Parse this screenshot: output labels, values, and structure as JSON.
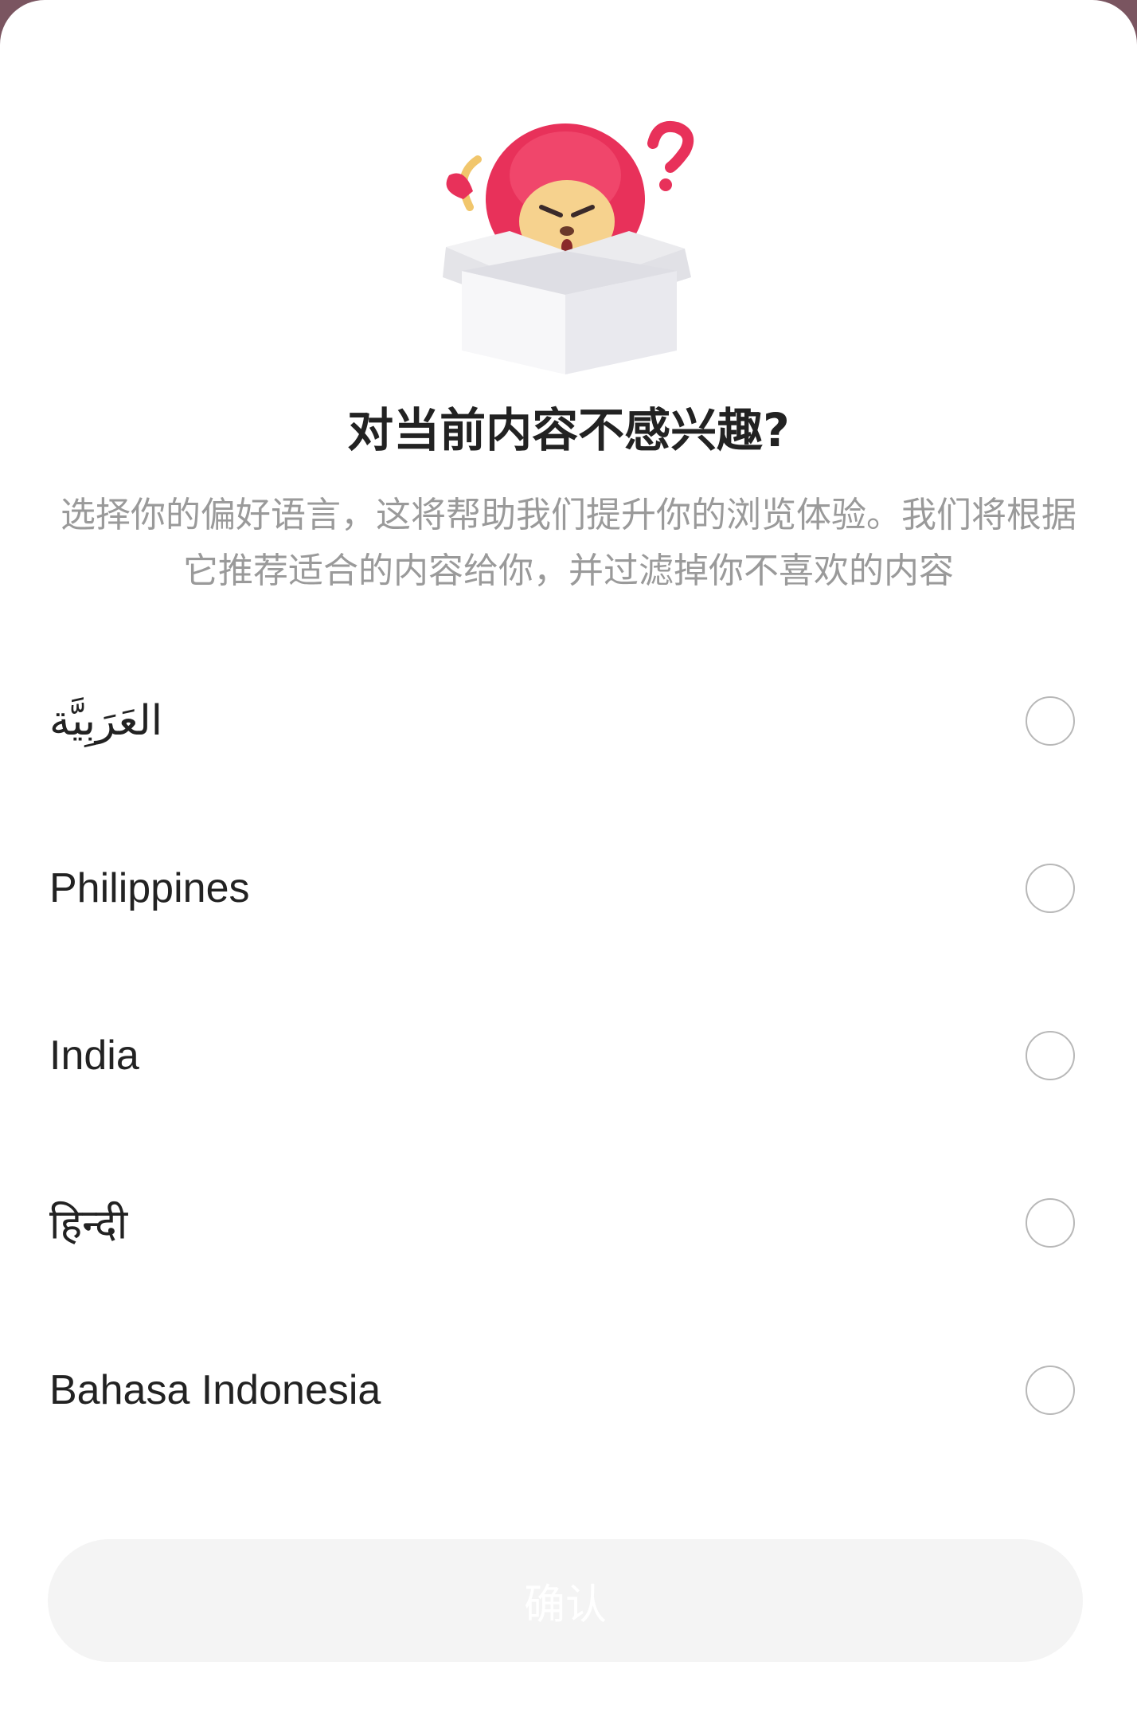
{
  "dialog": {
    "title": "对当前内容不感兴趣?",
    "subtitle": "选择你的偏好语言，这将帮助我们提升你的浏览体验。我们将根据它推荐适合的内容给你，并过滤掉你不喜欢的内容",
    "mascot_icon": "lion-in-box-question-mark-illustration"
  },
  "languages": [
    {
      "label": "العَرَبِيَّة",
      "selected": false
    },
    {
      "label": "Philippines",
      "selected": false
    },
    {
      "label": "India",
      "selected": false
    },
    {
      "label": "हिन्दी",
      "selected": false
    },
    {
      "label": "Bahasa Indonesia",
      "selected": false
    }
  ],
  "confirm": {
    "label": "确认",
    "enabled": false
  },
  "colors": {
    "accent": "#e8315a",
    "title": "#222222",
    "subtitle": "#9a9a9a",
    "radio_border": "#b8b8b8",
    "button_disabled_bg": "#f4f4f4"
  }
}
